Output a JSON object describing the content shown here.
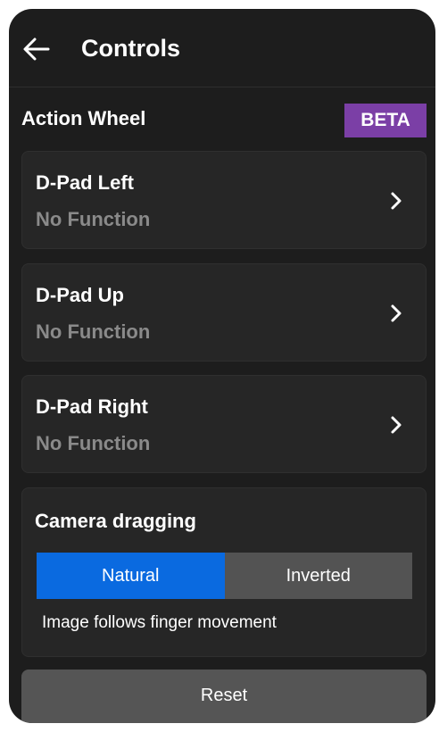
{
  "header": {
    "title": "Controls",
    "back_icon": "arrow-left-icon"
  },
  "action_wheel": {
    "title": "Action Wheel",
    "badge": "BETA",
    "badge_color": "#7b3fa6",
    "items": [
      {
        "title": "D-Pad Left",
        "value": "No Function"
      },
      {
        "title": "D-Pad Up",
        "value": "No Function"
      },
      {
        "title": "D-Pad Right",
        "value": "No Function"
      }
    ]
  },
  "camera": {
    "title": "Camera dragging",
    "options": [
      "Natural",
      "Inverted"
    ],
    "selected": "Natural",
    "description": "Image follows finger movement",
    "accent": "#0a6ae0"
  },
  "reset_label": "Reset"
}
